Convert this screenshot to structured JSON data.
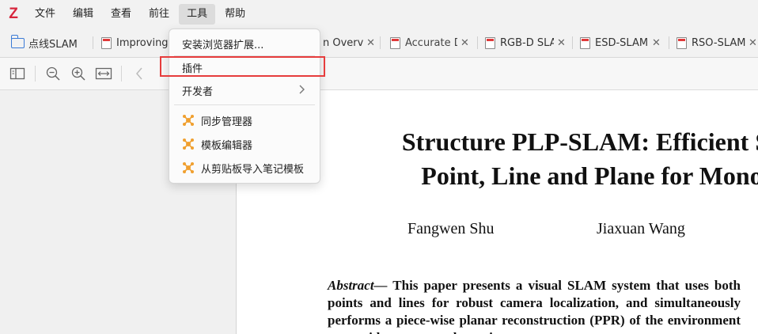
{
  "app": {
    "logo": "Z",
    "accent": "#d7263d"
  },
  "menubar": [
    "文件",
    "编辑",
    "查看",
    "前往",
    "工具",
    "帮助"
  ],
  "tabs": [
    {
      "title": "点线SLAM",
      "kind": "library"
    },
    {
      "title": "Improving",
      "kind": "pdf"
    },
    {
      "title": "n Overvie",
      "kind": "pdf"
    },
    {
      "title": "Accurate D",
      "kind": "pdf"
    },
    {
      "title": "RGB-D SLA",
      "kind": "pdf"
    },
    {
      "title": "ESD-SLAM",
      "kind": "pdf"
    },
    {
      "title": "RSO-SLAM",
      "kind": "pdf"
    }
  ],
  "tools_menu": {
    "items": [
      {
        "label": "安装浏览器扩展..."
      },
      {
        "label": "插件"
      },
      {
        "label": "开发者"
      },
      {
        "label": "同步管理器",
        "icon": "puzzle-icon"
      },
      {
        "label": "模板编辑器",
        "icon": "puzzle-icon"
      },
      {
        "label": "从剪贴板导入笔记模板",
        "icon": "puzzle-icon"
      }
    ],
    "highlight_color": "#e63c3c",
    "plugin_icon_color": "#f0a030"
  },
  "document": {
    "title_line1": "Structure PLP-SLAM: Efficient Spar",
    "title_line2": "Point, Line and Plane for Monocu",
    "author1": "Fangwen Shu",
    "author2": "Jiaxuan Wang",
    "abstract_lead": "Abstract—",
    "abstract_line1": " This paper presents a visual SLAM system that",
    "abstract_line2": "uses both points and lines for robust camera localization, and",
    "abstract_line3": "simultaneously performs a piece-wise planar reconstruction",
    "abstract_line4": "(PPR) of the environment to provide a structural map in"
  }
}
